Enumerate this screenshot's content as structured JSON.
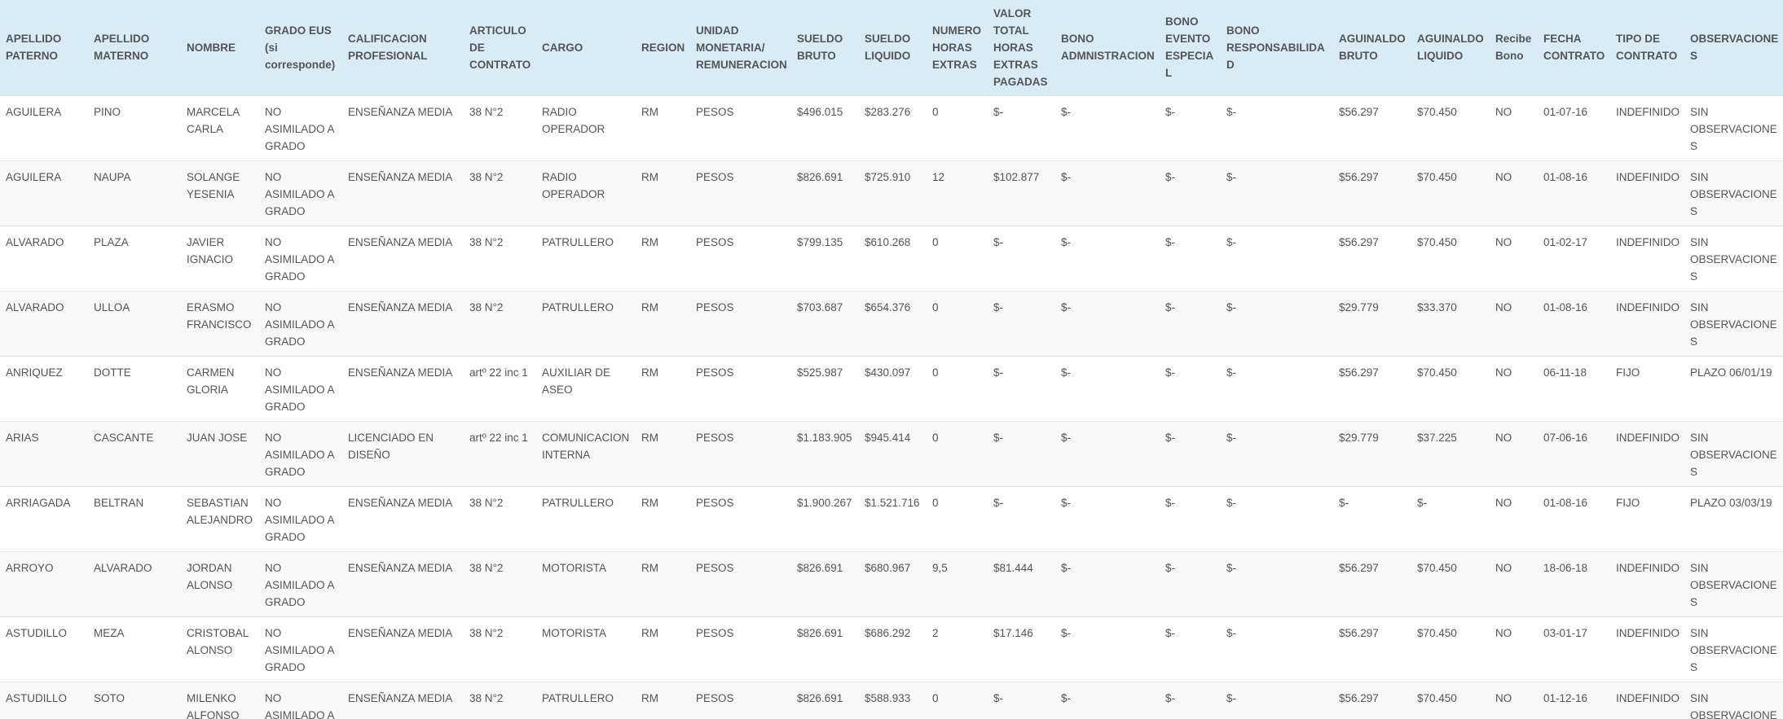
{
  "table": {
    "columns": [
      "APELLIDO PATERNO",
      "APELLIDO MATERNO",
      "NOMBRE",
      "GRADO EUS (si corresponde)",
      "CALIFICACION PROFESIONAL",
      "ARTICULO DE CONTRATO",
      "CARGO",
      "REGION",
      "UNIDAD MONETARIA/ REMUNERACION",
      "SUELDO BRUTO",
      "SUELDO LIQUIDO",
      "NUMERO HORAS EXTRAS",
      "VALOR TOTAL HORAS EXTRAS PAGADAS",
      "BONO ADMNISTRACION",
      "BONO EVENTO ESPECIAL",
      "BONO RESPONSABILIDAD",
      "AGUINALDO BRUTO",
      "AGUINALDO LIQUIDO",
      "Recibe Bono",
      "FECHA CONTRATO",
      "TIPO DE CONTRATO",
      "OBSERVACIONES"
    ],
    "rows": [
      [
        "AGUILERA",
        "PINO",
        "MARCELA CARLA",
        "NO ASIMILADO A GRADO",
        "ENSEÑANZA MEDIA",
        "38 N°2",
        "RADIO OPERADOR",
        "RM",
        "PESOS",
        "$496.015",
        "$283.276",
        "0",
        "$-",
        "$-",
        "$-",
        "$-",
        "$56.297",
        "$70.450",
        "NO",
        "01-07-16",
        "INDEFINIDO",
        "SIN OBSERVACIONES"
      ],
      [
        "AGUILERA",
        "NAUPA",
        "SOLANGE YESENIA",
        "NO ASIMILADO A GRADO",
        "ENSEÑANZA MEDIA",
        "38 N°2",
        "RADIO OPERADOR",
        "RM",
        "PESOS",
        "$826.691",
        "$725.910",
        "12",
        "$102.877",
        "$-",
        "$-",
        "$-",
        "$56.297",
        "$70.450",
        "NO",
        "01-08-16",
        "INDEFINIDO",
        "SIN OBSERVACIONES"
      ],
      [
        "ALVARADO",
        "PLAZA",
        "JAVIER IGNACIO",
        "NO ASIMILADO A GRADO",
        "ENSEÑANZA MEDIA",
        "38 N°2",
        "PATRULLERO",
        "RM",
        "PESOS",
        "$799.135",
        "$610.268",
        "0",
        "$-",
        "$-",
        "$-",
        "$-",
        "$56.297",
        "$70.450",
        "NO",
        "01-02-17",
        "INDEFINIDO",
        "SIN OBSERVACIONES"
      ],
      [
        "ALVARADO",
        "ULLOA",
        "ERASMO FRANCISCO",
        "NO ASIMILADO A GRADO",
        "ENSEÑANZA MEDIA",
        "38 N°2",
        "PATRULLERO",
        "RM",
        "PESOS",
        "$703.687",
        "$654.376",
        "0",
        "$-",
        "$-",
        "$-",
        "$-",
        "$29.779",
        "$33.370",
        "NO",
        "01-08-16",
        "INDEFINIDO",
        "SIN OBSERVACIONES"
      ],
      [
        "ANRIQUEZ",
        "DOTTE",
        "CARMEN GLORIA",
        "NO ASIMILADO A GRADO",
        "ENSEÑANZA MEDIA",
        "artº 22 inc 1",
        "AUXILIAR DE ASEO",
        "RM",
        "PESOS",
        "$525.987",
        "$430.097",
        "0",
        "$-",
        "$-",
        "$-",
        "$-",
        "$56.297",
        "$70.450",
        "NO",
        "06-11-18",
        "FIJO",
        "PLAZO 06/01/19"
      ],
      [
        "ARIAS",
        "CASCANTE",
        "JUAN JOSE",
        "NO ASIMILADO A GRADO",
        "LICENCIADO EN DISEÑO",
        "artº 22 inc 1",
        "COMUNICACION INTERNA",
        "RM",
        "PESOS",
        "$1.183.905",
        "$945.414",
        "0",
        "$-",
        "$-",
        "$-",
        "$-",
        "$29.779",
        "$37.225",
        "NO",
        "07-06-16",
        "INDEFINIDO",
        "SIN OBSERVACIONES"
      ],
      [
        "ARRIAGADA",
        "BELTRAN",
        "SEBASTIAN ALEJANDRO",
        "NO ASIMILADO A GRADO",
        "ENSEÑANZA MEDIA",
        "38 N°2",
        "PATRULLERO",
        "RM",
        "PESOS",
        "$1.900.267",
        "$1.521.716",
        "0",
        "$-",
        "$-",
        "$-",
        "$-",
        "$-",
        "$-",
        "NO",
        "01-08-16",
        "FIJO",
        "PLAZO 03/03/19"
      ],
      [
        "ARROYO",
        "ALVARADO",
        "JORDAN ALONSO",
        "NO ASIMILADO A GRADO",
        "ENSEÑANZA MEDIA",
        "38 N°2",
        "MOTORISTA",
        "RM",
        "PESOS",
        "$826.691",
        "$680.967",
        "9,5",
        "$81.444",
        "$-",
        "$-",
        "$-",
        "$56.297",
        "$70.450",
        "NO",
        "18-06-18",
        "INDEFINIDO",
        "SIN OBSERVACIONES"
      ],
      [
        "ASTUDILLO",
        "MEZA",
        "CRISTOBAL ALONSO",
        "NO ASIMILADO A GRADO",
        "ENSEÑANZA MEDIA",
        "38 N°2",
        "MOTORISTA",
        "RM",
        "PESOS",
        "$826.691",
        "$686.292",
        "2",
        "$17.146",
        "$-",
        "$-",
        "$-",
        "$56.297",
        "$70.450",
        "NO",
        "03-01-17",
        "INDEFINIDO",
        "SIN OBSERVACIONES"
      ],
      [
        "ASTUDILLO",
        "SOTO",
        "MILENKO ALFONSO",
        "NO ASIMILADO A GRADO",
        "ENSEÑANZA MEDIA",
        "38 N°2",
        "PATRULLERO",
        "RM",
        "PESOS",
        "$826.691",
        "$588.933",
        "0",
        "$-",
        "$-",
        "$-",
        "$-",
        "$56.297",
        "$70.450",
        "NO",
        "01-12-16",
        "INDEFINIDO",
        "SIN OBSERVACIONES"
      ]
    ]
  }
}
